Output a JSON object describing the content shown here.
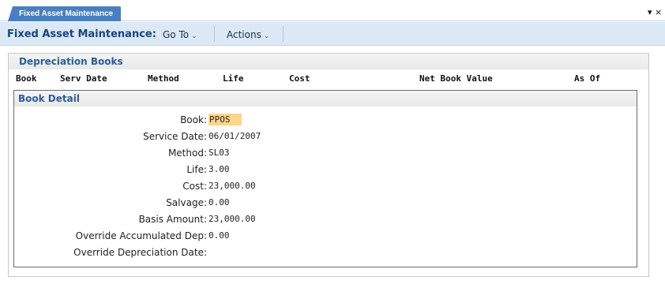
{
  "tab": {
    "label": "Fixed Asset Maintenance",
    "menu_glyph": "▾ ×"
  },
  "toolbar": {
    "title": "Fixed Asset Maintenance:",
    "goto_label": "Go To",
    "actions_label": "Actions",
    "chevron": "⌄"
  },
  "books": {
    "title": "Depreciation Books",
    "columns": [
      "Book",
      "Serv Date",
      "Method",
      "Life",
      "Cost",
      "Net Book Value",
      "As Of"
    ]
  },
  "detail": {
    "title": "Book Detail",
    "fields": [
      {
        "label": "Book:",
        "value": "PPOS"
      },
      {
        "label": "Service Date:",
        "value": "06/01/2007"
      },
      {
        "label": "Method:",
        "value": "SL03"
      },
      {
        "label": "Life:",
        "value": "3.00"
      },
      {
        "label": "Cost:",
        "value": "23,000.00"
      },
      {
        "label": "Salvage:",
        "value": "0.00"
      },
      {
        "label": "Basis Amount:",
        "value": "23,000.00"
      },
      {
        "label": "Override Accumulated Dep:",
        "value": "0.00"
      },
      {
        "label": "Override Depreciation Date:",
        "value": ""
      }
    ]
  },
  "colors": {
    "tab_bg": "#4a7fbf",
    "toolbar_bg": "#dbe8f6",
    "title_color": "#17457a",
    "section_title": "#2c5d96",
    "highlight": "#ffd58a"
  }
}
